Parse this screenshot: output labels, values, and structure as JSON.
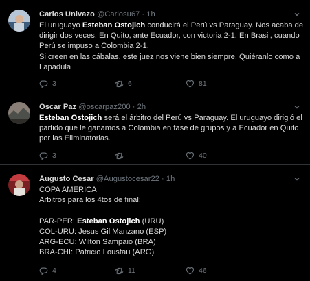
{
  "tweets": [
    {
      "name": "Carlos Univazo",
      "handle": "@Carlosu67",
      "dot": "·",
      "time": "1h",
      "lines": [
        [
          {
            "t": "El uruguayo "
          },
          {
            "t": "Esteban Ostojich",
            "b": true
          },
          {
            "t": " conducirá el Perú vs Paraguay. Nos acaba de"
          }
        ],
        [
          {
            "t": "dirigir dos veces: En Quito, ante Ecuador, con victoria 2-1. En Brasil, cuando"
          }
        ],
        [
          {
            "t": "Perú se impuso a Colombia 2-1."
          }
        ],
        [
          {
            "t": "Si creen en las cábalas, este juez nos viene bien siempre. Quiéranlo como a"
          }
        ],
        [
          {
            "t": "Lapadula"
          }
        ]
      ],
      "replies": "3",
      "retweets": "6",
      "likes": "81"
    },
    {
      "name": "Oscar Paz",
      "handle": "@oscarpaz200",
      "dot": "·",
      "time": "2h",
      "lines": [
        [
          {
            "t": "Esteban Ostojich",
            "b": true
          },
          {
            "t": " será el árbitro del Perú vs Paraguay. El uruguayo dirigió el"
          }
        ],
        [
          {
            "t": "partido que le ganamos a Colombia en fase de grupos y a Ecuador en Quito"
          }
        ],
        [
          {
            "t": "por las Eliminatorias."
          }
        ]
      ],
      "replies": "3",
      "retweets": "",
      "likes": "40"
    },
    {
      "name": "Augusto Cesar",
      "handle": "@Augustocesar22",
      "dot": "·",
      "time": "1h",
      "lines": [
        [
          {
            "t": "COPA AMERICA"
          }
        ],
        [
          {
            "t": "Arbitros para los 4tos de final:"
          }
        ],
        [
          {
            "t": ""
          }
        ],
        [
          {
            "t": "PAR-PER: "
          },
          {
            "t": "Esteban Ostojich",
            "b": true
          },
          {
            "t": " (URU)"
          }
        ],
        [
          {
            "t": "COL-URU: Jesus Gil Manzano (ESP)"
          }
        ],
        [
          {
            "t": "ARG-ECU: Wilton Sampaio (BRA)"
          }
        ],
        [
          {
            "t": "BRA-CHI: Patricio Loustau (ARG)"
          }
        ]
      ],
      "replies": "4",
      "retweets": "11",
      "likes": "46"
    }
  ],
  "icons": {
    "reply": "reply-icon",
    "retweet": "retweet-icon",
    "like": "like-icon",
    "share": "share-icon",
    "caret": "chevron-down-icon"
  },
  "colors": {
    "background": "#000000",
    "text": "#d9d9d9",
    "muted": "#6e767d",
    "divider": "#2f3336"
  }
}
